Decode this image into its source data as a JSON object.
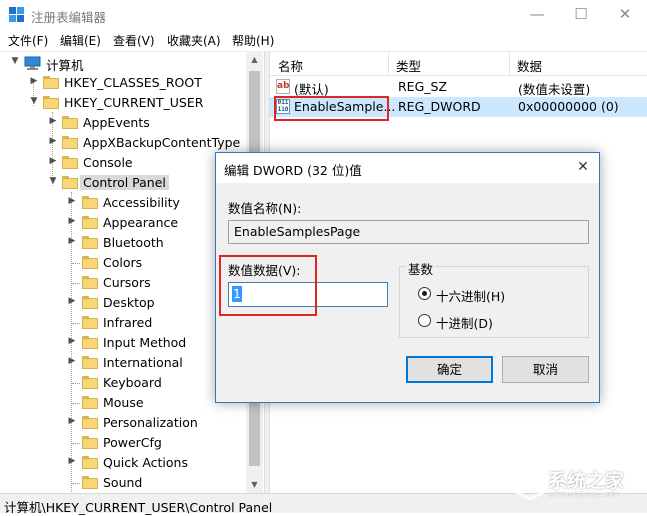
{
  "window": {
    "title": "注册表编辑器",
    "minimize": "—",
    "maximize": "☐",
    "close": "✕"
  },
  "menu": [
    "文件(F)",
    "编辑(E)",
    "查看(V)",
    "收藏夹(A)",
    "帮助(H)"
  ],
  "tree": {
    "root": "计算机",
    "hkcr": "HKEY_CLASSES_ROOT",
    "hkcu": "HKEY_CURRENT_USER",
    "hkcu_children": [
      "AppEvents",
      "AppXBackupContentType",
      "Console",
      "Control Panel"
    ],
    "control_panel_children": [
      "Accessibility",
      "Appearance",
      "Bluetooth",
      "Colors",
      "Cursors",
      "Desktop",
      "Infrared",
      "Input Method",
      "International",
      "Keyboard",
      "Mouse",
      "Personalization",
      "PowerCfg",
      "Quick Actions",
      "Sound"
    ],
    "selected": "Control Panel"
  },
  "list": {
    "columns": [
      "名称",
      "类型",
      "数据"
    ],
    "rows": [
      {
        "name": "(默认)",
        "type": "REG_SZ",
        "data": "(数值未设置)",
        "icon": "string-value-icon"
      },
      {
        "name": "EnableSample...",
        "type": "REG_DWORD",
        "data": "0x00000000 (0)",
        "icon": "dword-value-icon"
      }
    ]
  },
  "status": {
    "path": "计算机\\HKEY_CURRENT_USER\\Control Panel"
  },
  "dialog": {
    "title": "编辑 DWORD (32 位)值",
    "close": "✕",
    "name_label": "数值名称(N):",
    "name_value": "EnableSamplesPage",
    "value_label": "数值数据(V):",
    "value": "1",
    "base_label": "基数",
    "hex_label": "十六进制(H)",
    "dec_label": "十进制(D)",
    "selected_base": "hex",
    "ok": "确定",
    "cancel": "取消"
  },
  "watermark": {
    "text": "系统之家",
    "sub": "XITONGZHIJIA.NET"
  },
  "colors": {
    "accent": "#0078d7",
    "selection": "#cce8ff",
    "highlight_box": "#e02525",
    "folder": "#f6d676"
  }
}
